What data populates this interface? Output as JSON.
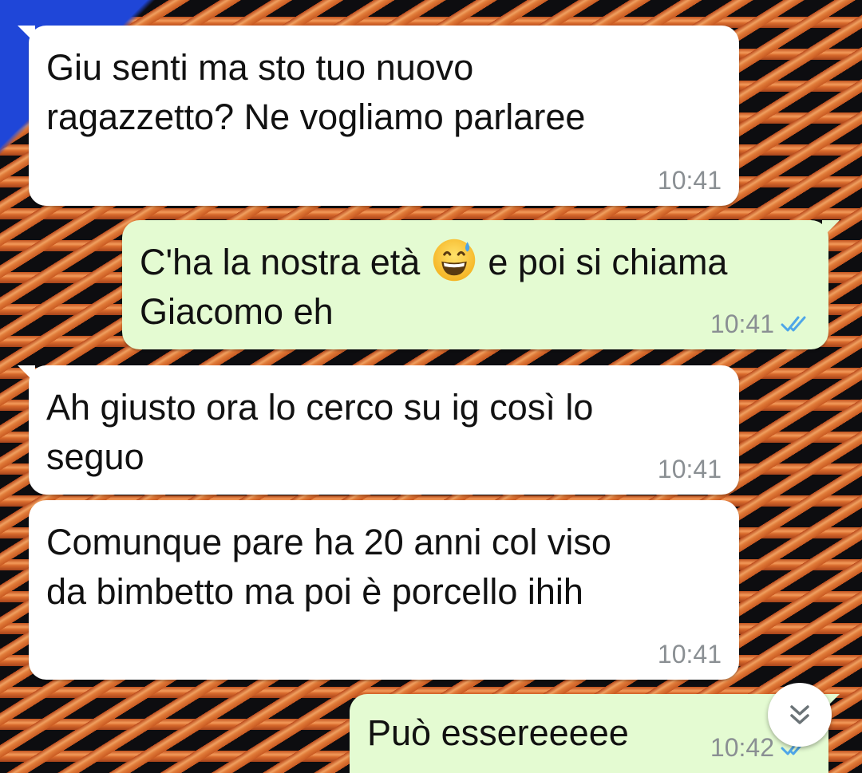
{
  "messages": [
    {
      "direction": "incoming",
      "text": "Giu senti ma sto tuo nuovo\nragazzetto? Ne vogliamo parlaree",
      "time": "10:41"
    },
    {
      "direction": "outgoing",
      "text_before_emoji": "C'ha la nostra età ",
      "emoji": "grinning-face-with-sweat",
      "text_after_emoji": " e poi si chiama\nGiacomo eh",
      "time": "10:41",
      "status": "read"
    },
    {
      "direction": "incoming",
      "text": "Ah giusto ora lo cerco su ig così lo\nseguo",
      "time": "10:41"
    },
    {
      "direction": "incoming",
      "text": "Comunque pare ha 20 anni col viso\nda bimbetto ma poi è porcello ihih",
      "time": "10:41"
    },
    {
      "direction": "outgoing",
      "text": "Può essereeeee",
      "time": "10:42",
      "status": "read"
    }
  ],
  "scroll_button": {
    "icon": "double-chevron-down-icon"
  },
  "colors": {
    "incoming_bubble": "#ffffff",
    "outgoing_bubble": "#e4fbd2",
    "timestamp": "#8a8f93",
    "read_ticks": "#4fa6e8"
  }
}
